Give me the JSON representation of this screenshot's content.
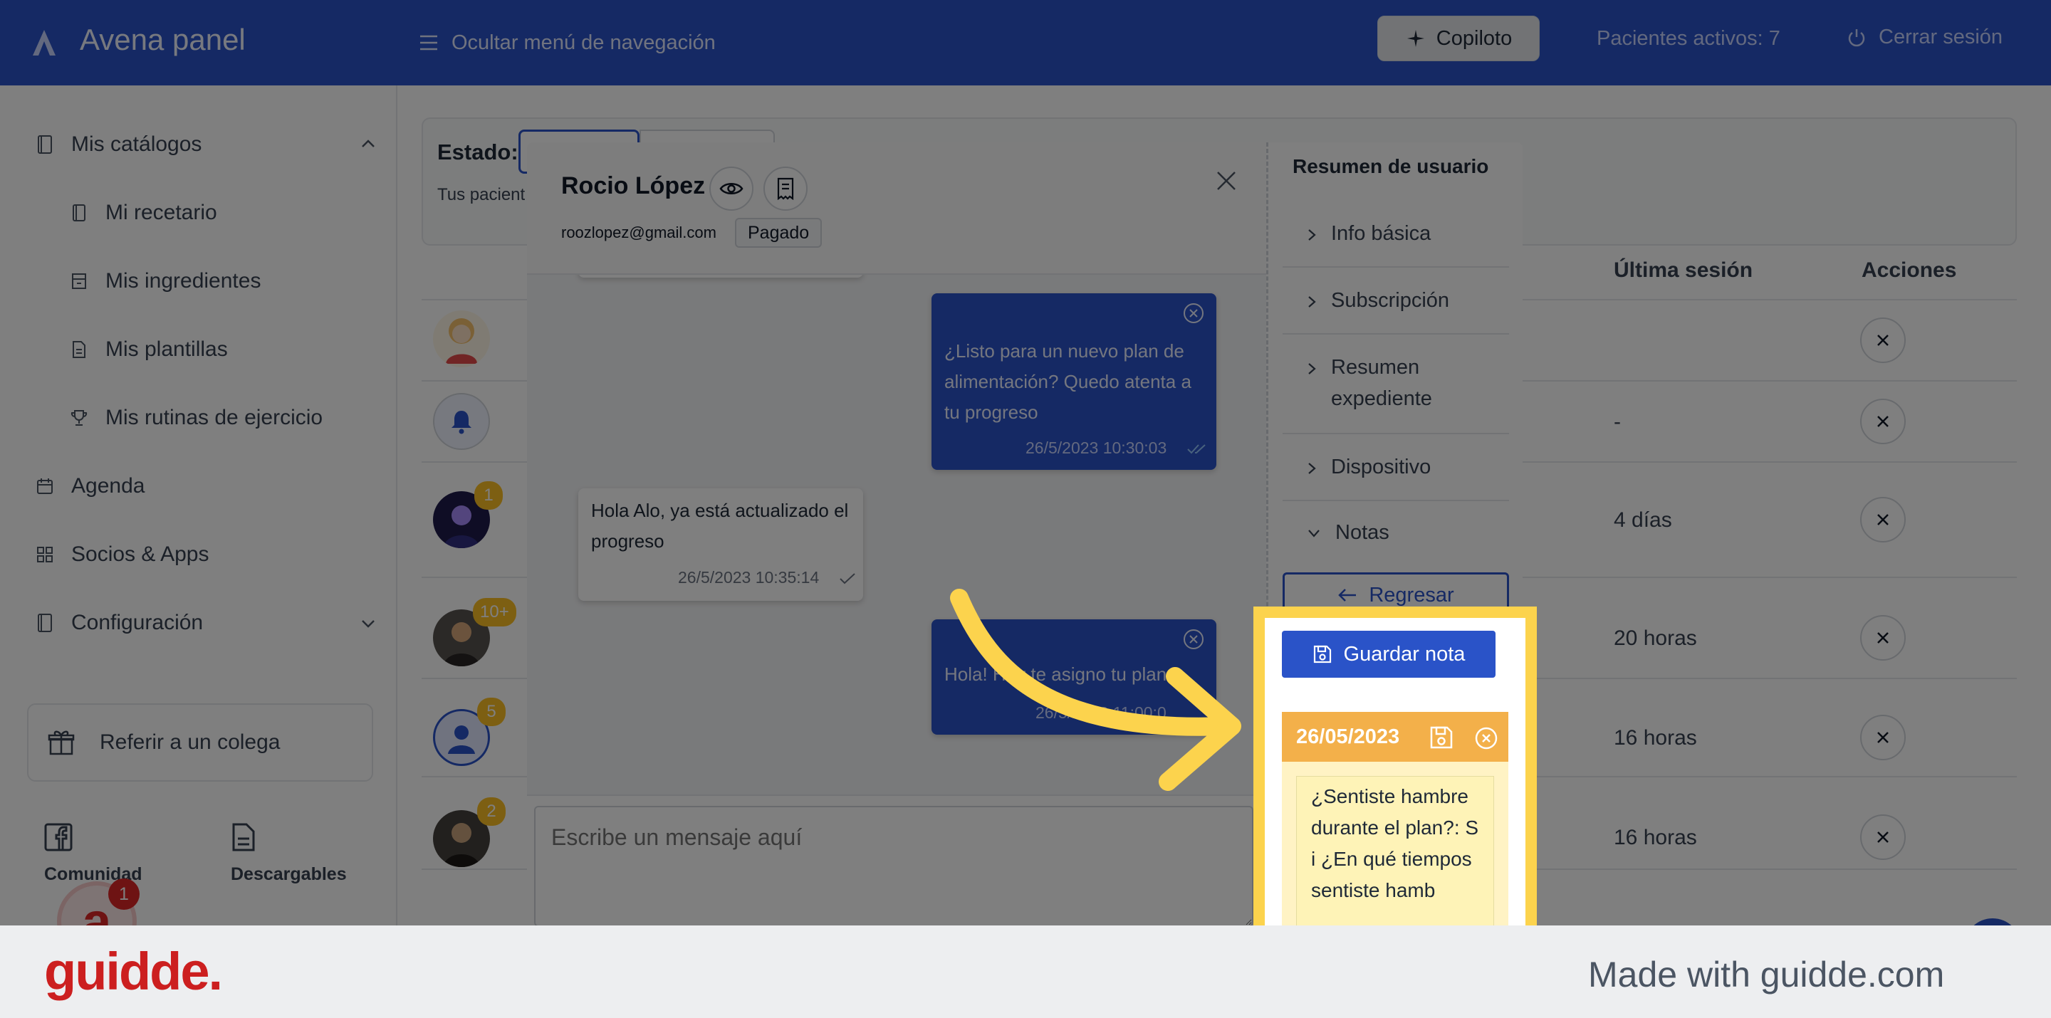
{
  "header": {
    "app_title": "Avena panel",
    "nav_toggle_label": "Ocultar menú de navegación",
    "copilot_label": "Copiloto",
    "active_patients": "Pacientes activos: 7",
    "logout_label": "Cerrar sesión",
    "brand_color": "#2a53c8"
  },
  "sidebar": {
    "catalogs_label": "Mis catálogos",
    "catalog_items": [
      {
        "label": "Mi recetario",
        "icon": "book-icon"
      },
      {
        "label": "Mis ingredientes",
        "icon": "store-icon"
      },
      {
        "label": "Mis plantillas",
        "icon": "file-icon"
      },
      {
        "label": "Mis rutinas de ejercicio",
        "icon": "trophy-icon"
      }
    ],
    "agenda_label": "Agenda",
    "partners_label": "Socios & Apps",
    "config_label": "Configuración",
    "referral_label": "Referir a un colega",
    "community_label": "Comunidad",
    "downloads_label": "Descargables",
    "avatar_letter": "a",
    "avatar_badge": "1"
  },
  "main": {
    "state_label": "Estado:",
    "patients_note": "Tus pacient",
    "columns": {
      "last_session": "Última sesión",
      "actions": "Acciones"
    },
    "rows": [
      {
        "badge": "",
        "last_session": ""
      },
      {
        "badge": "",
        "last_session": "-"
      },
      {
        "badge": "1",
        "last_session": "4 días"
      },
      {
        "badge": "10+",
        "last_session": "20 horas"
      },
      {
        "badge": "5",
        "last_session": "16 horas"
      },
      {
        "badge": "2",
        "last_session": "16 horas"
      }
    ]
  },
  "modal": {
    "patient_name": "Rocio López",
    "patient_email": "roozlopez@gmail.com",
    "payment_status": "Pagado",
    "messages": [
      {
        "from": "me",
        "text": "¿Listo para un nuevo plan de alimentación? Quedo atenta a tu progreso",
        "time": "26/5/2023 10:30:03"
      },
      {
        "from": "patient",
        "text": "Hola Alo, ya está actualizado el progreso",
        "time": "26/5/2023 10:35:14"
      },
      {
        "from": "me",
        "text": "Hola! Hoy te asigno tu plan",
        "time": "26/5/2023 11:00:0"
      }
    ],
    "message_placeholder": "Escribe un mensaje aquí",
    "summary": {
      "title": "Resumen de usuario",
      "sections": [
        "Info básica",
        "Subscripción",
        "Resumen expediente",
        "Dispositivo",
        "Notas"
      ],
      "back_label": "Regresar",
      "save_note_label": "Guardar nota",
      "note_date": "26/05/2023",
      "note_text": "¿Sentiste hambre durante el plan?: Si ¿En qué tiempos sentiste hamb"
    }
  },
  "footer": {
    "brand": "guidde.",
    "made_with": "Made with guidde.com"
  }
}
